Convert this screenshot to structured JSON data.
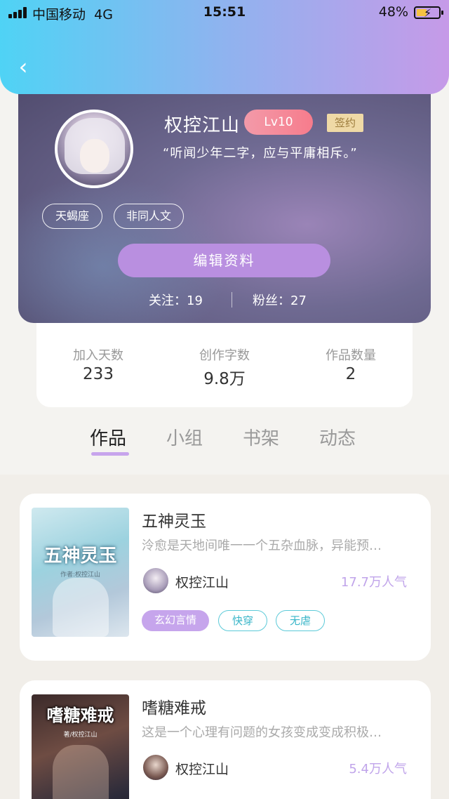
{
  "status_bar": {
    "carrier": "中国移动",
    "network": "4G",
    "time": "15:51",
    "battery": "48%"
  },
  "nav": {
    "back_icon": "chevron-left-icon"
  },
  "profile": {
    "name": "权控江山",
    "level": "Lv10",
    "sign_badge": "签约",
    "motto": "“听闻少年二字，应与平庸相斥。”",
    "tags": [
      "天蝎座",
      "非同人文"
    ],
    "edit_button": "编辑资料",
    "follow": "关注：19",
    "fans": "粉丝：27"
  },
  "stats": [
    {
      "label": "加入天数",
      "value": "233"
    },
    {
      "label": "创作字数",
      "value": "9.8万"
    },
    {
      "label": "作品数量",
      "value": "2"
    }
  ],
  "tabs": [
    "作品",
    "小组",
    "书架",
    "动态"
  ],
  "active_tab": "作品",
  "works": [
    {
      "cover_title": "五神灵玉",
      "cover_sub": "作者:权控江山",
      "title": "五神灵玉",
      "desc": "泠愈是天地间唯一一个五杂血脉，异能预…",
      "author": "权控江山",
      "popularity": "17.7万人气",
      "tags": [
        "玄幻言情",
        "快穿",
        "无虐"
      ]
    },
    {
      "cover_title": "嗜糖难戒",
      "cover_sub": "著/权控江山",
      "title": "嗜糖难戒",
      "desc": "这是一个心理有问题的女孩变成变成积极…",
      "author": "权控江山",
      "popularity": "5.4万人气",
      "tags": []
    }
  ],
  "colors": {
    "accent": "#b98fe0",
    "header_start": "#4fd3f5",
    "header_end": "#c69ae8",
    "tag_teal": "#38b5c8"
  }
}
